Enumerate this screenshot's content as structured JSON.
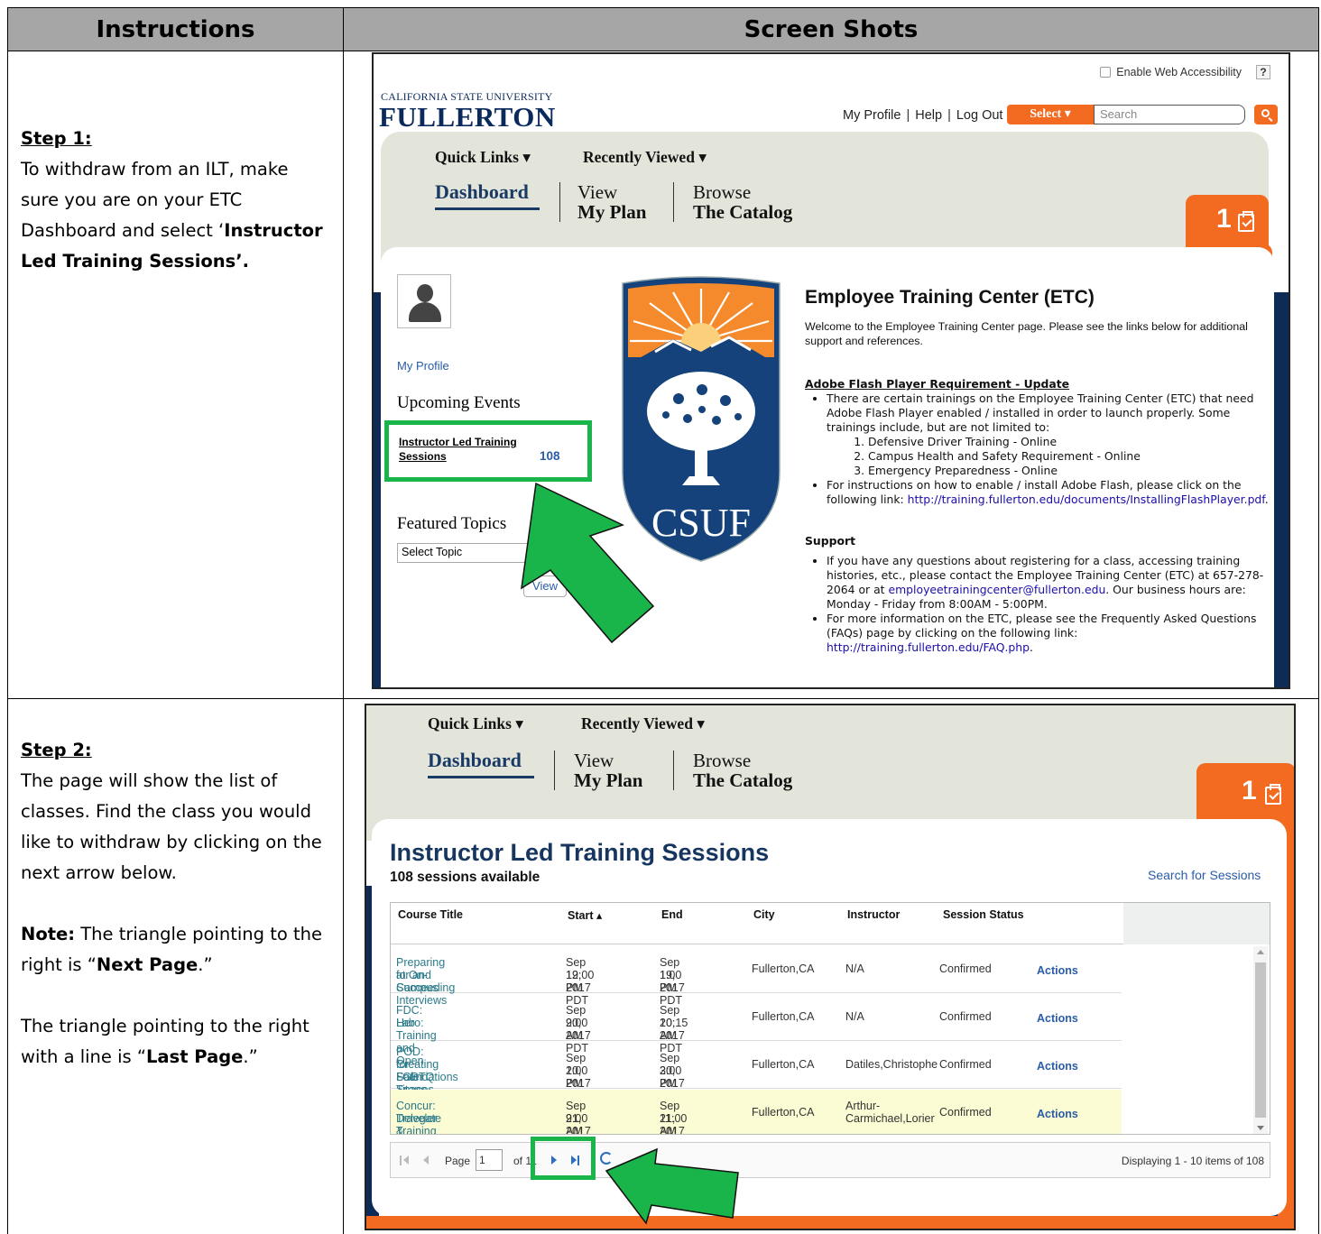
{
  "header": {
    "instructions": "Instructions",
    "screenshots": "Screen Shots"
  },
  "step1": {
    "heading": "Step 1:",
    "text_before": "To withdraw from an ILT, make sure you are on your ETC Dashboard and select ‘",
    "text_bold": "Instructor Led Training Sessions’."
  },
  "step2": {
    "heading": "Step 2:",
    "text": "The page will show the list of classes. Find the class you would like to withdraw by clicking on the next arrow below.",
    "note_label": "Note:",
    "note_before": " The triangle pointing to the right is “",
    "note_bold": "Next Page",
    "note_after": ".”",
    "last_before": "The triangle pointing to the right with a line is “",
    "last_bold": "Last Page",
    "last_after": ".”"
  },
  "site": {
    "enable_accessibility": "Enable Web Accessibility",
    "help_q": "?",
    "logo_top": "CALIFORNIA STATE UNIVERSITY",
    "logo_main": "FULLERTON",
    "my_profile": "My Profile",
    "help": "Help",
    "log_out": "Log Out",
    "select_label": "Select ▾",
    "search_placeholder": "Search",
    "quick_links": "Quick Links ▾",
    "recently_viewed": "Recently Viewed ▾",
    "dashboard": "Dashboard",
    "view": "View",
    "my_plan": "My Plan",
    "browse": "Browse",
    "the_catalog": "The Catalog",
    "badge_count": "1"
  },
  "dashboard": {
    "my_profile_link": "My Profile",
    "upcoming_events": "Upcoming Events",
    "ilt_line1": "Instructor Led Training",
    "ilt_line2": "Sessions",
    "ilt_count": "108",
    "featured_topics": "Featured Topics",
    "select_topic": "Select Topic",
    "view_button": "View",
    "seal_text": "CSUF",
    "etc_title": "Employee Training Center (ETC)",
    "welcome": "Welcome to the Employee Training Center page. Please see the links below for additional support and references.",
    "flash_heading": "Adobe Flash Player Requirement - Update",
    "flash_bullet1": "There are certain trainings on the Employee Training Center (ETC) that need Adobe Flash Player enabled / installed in order to launch properly. Some trainings include, but are not limited to:",
    "flash_items": [
      "Defensive Driver Training - Online",
      "Campus Health and Safety Requirement - Online",
      "Emergency Preparedness - Online"
    ],
    "flash_bullet2": "For instructions on how to enable / install Adobe Flash, please click on the following link: ",
    "flash_link": "http://training.fullerton.edu/documents/InstallingFlashPlayer.pdf",
    "flash_link_after": ".",
    "support_heading": "Support",
    "support_b1_before": "If you have any questions about registering for a class, accessing training histories, etc., please contact the Employee Training Center (ETC) at 657-278-2064 or at ",
    "support_email": "employeetrainingcenter@fullerton.edu",
    "support_b1_after": ". Our business hours are: Monday - Friday from 8:00AM - 5:00PM.",
    "support_b2_before": "For more information on the ETC, please see the Frequently Asked Questions (FAQs) page by clicking on the following link: ",
    "support_link": "http://training.fullerton.edu/FAQ.php",
    "support_b2_after": "."
  },
  "sessions": {
    "title": "Instructor Led Training Sessions",
    "subtitle": "108 sessions available",
    "search_link": "Search for Sessions",
    "columns": [
      "Course Title",
      "Start ▴",
      "End",
      "City",
      "Instructor",
      "Session Status"
    ],
    "rows": [
      {
        "title": [
          "Preparing for and Succeeding",
          "at On-Campus Interviews"
        ],
        "start": [
          "Sep 19, 2017",
          "12:00 PM PDT"
        ],
        "end": [
          "Sep 19, 2017",
          "1:00 PM PDT"
        ],
        "city": "Fullerton,CA",
        "instructor": [
          "N/A"
        ],
        "status": "Confirmed",
        "action": "Actions"
      },
      {
        "title": [
          "FDC: Hero: Training and Open",
          "Lab"
        ],
        "start": [
          "Sep 20, 2017",
          "9:00 AM PDT"
        ],
        "end": [
          "Sep 20, 2017",
          "10:15 AM PDT"
        ],
        "city": "Fullerton,CA",
        "instructor": [
          "N/A"
        ],
        "status": "Confirmed",
        "action": "Actions"
      },
      {
        "title": [
          "POD: Creating Safer Spaces",
          "for LGBTQ Titans -",
          "Foundations"
        ],
        "start": [
          "Sep 20, 2017",
          "1:00 PM PDT"
        ],
        "end": [
          "Sep 20, 2017",
          "3:00 PM PDT"
        ],
        "city": "Fullerton,CA",
        "instructor": [
          "Datiles,Christophe"
        ],
        "status": "Confirmed",
        "action": "Actions"
      },
      {
        "title": [
          "Concur: Traveler & Travel",
          "Delegate Training Class"
        ],
        "start": [
          "Sep 21, 2017",
          "9:00 AM PDT"
        ],
        "end": [
          "Sep 21, 2017",
          "11:00 AM PDT"
        ],
        "city": "Fullerton,CA",
        "instructor": [
          "Arthur-",
          "Carmichael,Lorier"
        ],
        "status": "Confirmed",
        "action": "Actions"
      }
    ],
    "pager_page": "Page",
    "pager_value": "1",
    "pager_of": "of 11",
    "displaying": "Displaying 1 - 10 items of 108"
  },
  "colors": {
    "orange": "#f26b21",
    "navy": "#0d2b55",
    "green_highlight": "#1ab54a",
    "nav_band": "#e3e5da"
  }
}
